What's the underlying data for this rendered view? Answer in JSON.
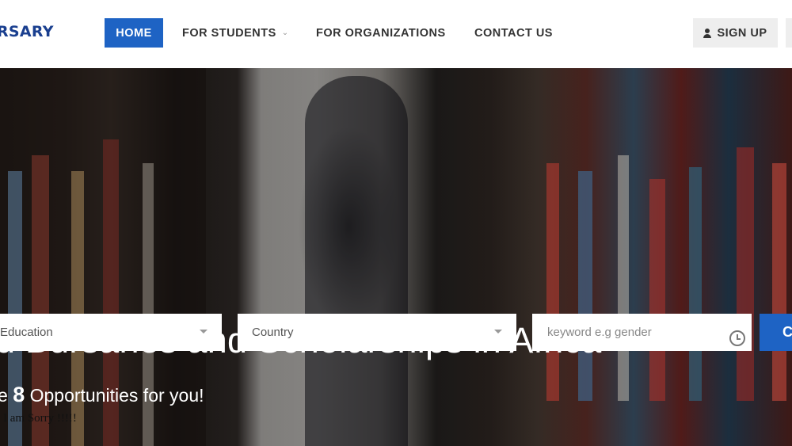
{
  "header": {
    "logo": "RSARY",
    "nav": {
      "home": "HOME",
      "students": "FOR STUDENTS",
      "organizations": "FOR ORGANIZATIONS",
      "contact": "CONTACT US"
    },
    "signup": "SIGN UP"
  },
  "hero": {
    "headline": "d Bursaries and Scholarships in Africa",
    "filters": {
      "education": "Education",
      "country": "Country",
      "keyword_placeholder": "keyword e.g gender"
    },
    "search_button": "C",
    "opportunities_prefix": "e ",
    "opportunities_count": "8",
    "opportunities_suffix": " Opportunities for you!",
    "sorry_text": "I am Sorry !!!!!"
  },
  "colors": {
    "brand_blue": "#1e63c4",
    "logo_blue": "#1a3f8f"
  }
}
